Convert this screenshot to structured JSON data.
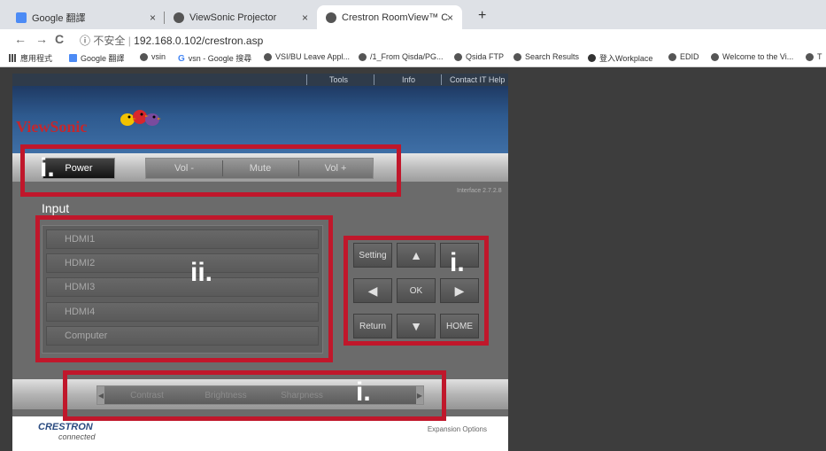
{
  "browser": {
    "tabs": [
      {
        "title": "Google 翻譯",
        "close": "×",
        "active": false
      },
      {
        "title": "ViewSonic Projector",
        "close": "×",
        "active": false
      },
      {
        "title": "Crestron RoomView™ Connect",
        "close": "×",
        "active": true
      }
    ],
    "new_tab": "+",
    "nav": {
      "back": "←",
      "forward": "→",
      "reload": "C"
    },
    "address": {
      "insecure_label": "不安全",
      "url": "192.168.0.102/crestron.asp"
    },
    "bookmarks": [
      "應用程式",
      "Google 翻譯",
      "vsin",
      "vsn - Google 搜尋",
      "VSI/BU Leave Appl...",
      "/1_From Qisda/PG...",
      "Qsida FTP",
      "Search Results",
      "登入Workplace",
      "EDID",
      "Welcome to the Vi...",
      "T"
    ]
  },
  "crestron": {
    "top_links": [
      "Tools",
      "Info",
      "Contact IT Help"
    ],
    "brand": "ViewSonic",
    "power_label": "Power",
    "volume_buttons": [
      "Vol -",
      "Mute",
      "Vol +"
    ],
    "interface_version": "Interface 2.7.2.8",
    "input_title": "Input",
    "inputs": [
      "HDMI1",
      "HDMI2",
      "HDMI3",
      "HDMI4",
      "Computer"
    ],
    "control_pad": {
      "setting": "Setting",
      "up": "▲",
      "left": "◀",
      "ok": "OK",
      "right": "▶",
      "return": "Return",
      "down": "▼",
      "home": "HOME"
    },
    "sliders": [
      "Contrast",
      "Brightness",
      "Sharpness"
    ],
    "slider_arrows": {
      "left": "◀",
      "right": "▶"
    },
    "footer": {
      "logo": "CRESTRON",
      "logo_sub": "connected",
      "expansion": "Expansion Options"
    }
  },
  "annotations": [
    "i.",
    "ii.",
    "i.",
    "i."
  ],
  "colors": {
    "annotation": "#c0172b",
    "brand_red": "#c4272d",
    "header_blue": "#2e5a8f"
  }
}
